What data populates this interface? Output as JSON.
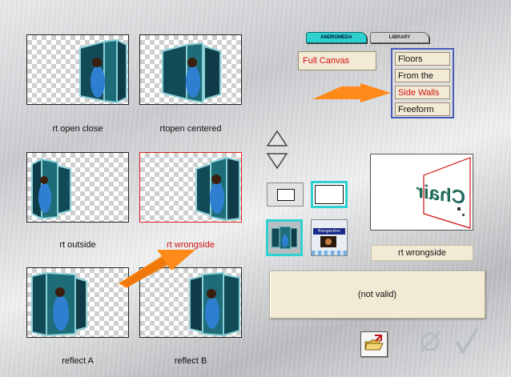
{
  "tabs": [
    {
      "label": "ANDROMEDA",
      "active": true
    },
    {
      "label": "LIBRARY",
      "active": false
    }
  ],
  "presets": [
    {
      "caption": "rt open close",
      "selected": false
    },
    {
      "caption": "rtopen centered",
      "selected": false
    },
    {
      "caption": "rt outside",
      "selected": false
    },
    {
      "caption": "rt wrongside",
      "selected": true
    },
    {
      "caption": "reflect A",
      "selected": false
    },
    {
      "caption": "reflect B",
      "selected": false
    }
  ],
  "canvas_mode": "Full Canvas",
  "mode_options": [
    "Floors",
    "From the Top",
    "Side Walls",
    "Freeform"
  ],
  "selected_mode": "Side Walls",
  "preview": {
    "text": "Chair",
    "name": "rt wrongside"
  },
  "status": "(not valid)",
  "colors": {
    "accent_red": "#d01010",
    "tab_cyan": "#2fd0d0",
    "list_border": "#4a5ab8",
    "pointer_orange": "#ff8a1a",
    "field_bg": "#f3ead6"
  },
  "icons": [
    "up-arrow-icon",
    "down-arrow-icon",
    "open-folder-icon",
    "cancel-icon",
    "ok-check-icon"
  ]
}
